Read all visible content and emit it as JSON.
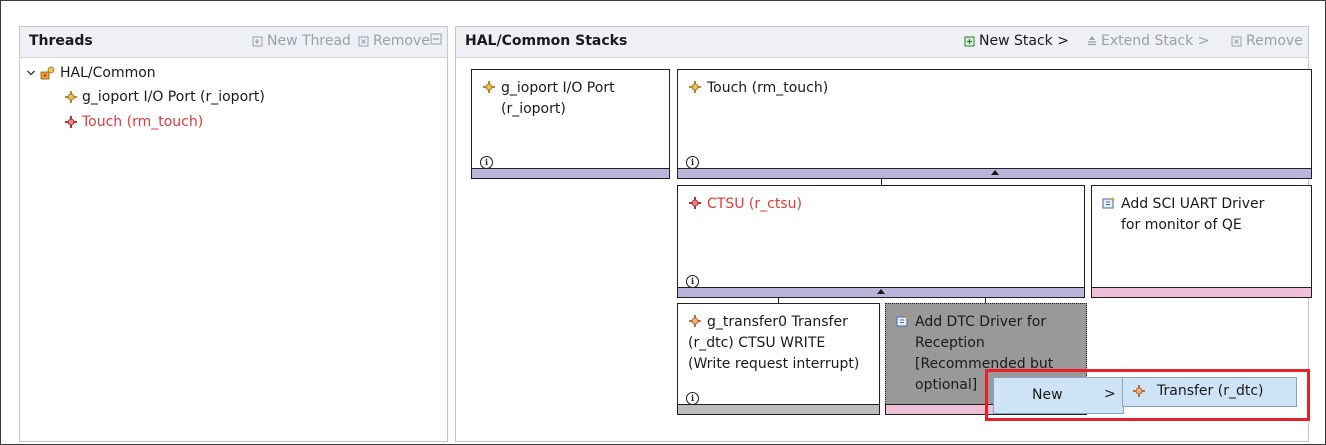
{
  "threads": {
    "title": "Threads",
    "new_thread_label": "New Thread",
    "remove_label": "Remove",
    "tree": {
      "root": "HAL/Common",
      "items": [
        {
          "label": "g_ioport I/O Port (r_ioport)",
          "color": "#1a1a1a"
        },
        {
          "label": "Touch (rm_touch)",
          "color": "#e03b3b"
        }
      ]
    }
  },
  "stacks": {
    "title": "HAL/Common Stacks",
    "new_stack_label": "New Stack >",
    "extend_stack_label": "Extend Stack >",
    "remove_label": "Remove",
    "modules": {
      "ioport": {
        "line1": "g_ioport I/O Port",
        "line2": "(r_ioport)"
      },
      "touch": {
        "line1": "Touch (rm_touch)"
      },
      "ctsu": {
        "line1": "CTSU (r_ctsu)"
      },
      "sci": {
        "line1": "Add SCI UART Driver",
        "line2": "for monitor of QE"
      },
      "transfer": {
        "line1": "g_transfer0 Transfer",
        "line2": "(r_dtc) CTSU WRITE",
        "line3": "(Write request interrupt)"
      },
      "dtc": {
        "line1": "Add DTC Driver for",
        "line2": "Reception",
        "line3": "[Recommended but",
        "line4": "optional]"
      }
    }
  },
  "context_menu": {
    "new_label": "New",
    "submenu_arrow": ">",
    "transfer_label": "Transfer (r_dtc)"
  },
  "colors": {
    "accent_red": "#e8202a",
    "module_red": "#e03b3b",
    "bar_purple": "#b9b4d9",
    "bar_pink": "#f0c0d8",
    "menu_blue": "#cfe3f6"
  },
  "icons": {
    "expand": "chevron-down-icon",
    "folder": "hal-folder-icon",
    "module": "module-icon",
    "info": "info-icon",
    "add": "add-module-icon"
  }
}
